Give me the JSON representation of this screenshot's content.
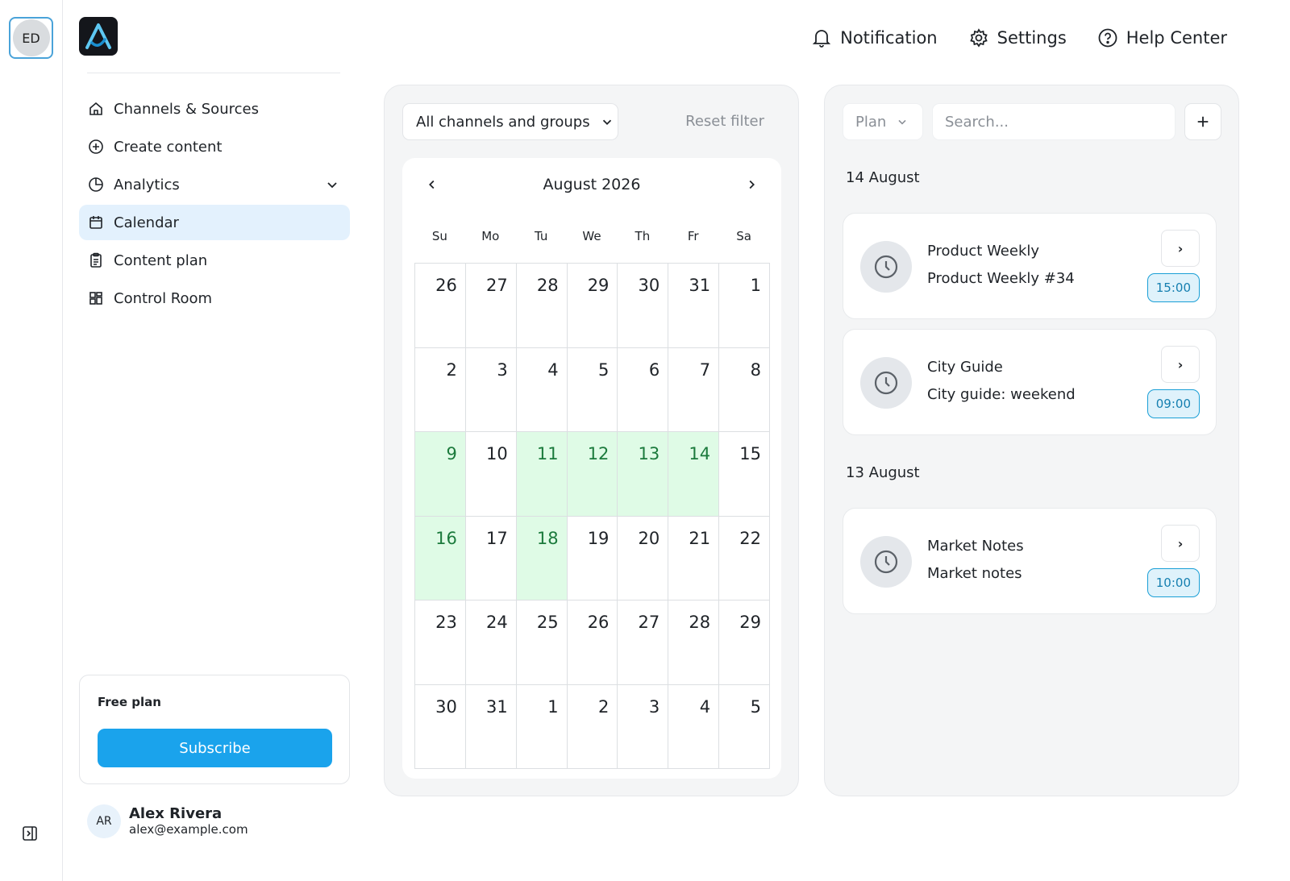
{
  "workspace": {
    "initials": "ED"
  },
  "sidebar": {
    "items": [
      {
        "label": "Channels & Sources",
        "icon": "home-icon"
      },
      {
        "label": "Create content",
        "icon": "plus-circle-icon"
      },
      {
        "label": "Analytics",
        "icon": "pie-chart-icon",
        "expandable": true
      },
      {
        "label": "Calendar",
        "icon": "calendar-icon",
        "active": true
      },
      {
        "label": "Content plan",
        "icon": "clipboard-icon"
      },
      {
        "label": "Control Room",
        "icon": "grid-icon"
      }
    ],
    "plan": {
      "label": "Free plan",
      "subscribe_label": "Subscribe"
    },
    "user": {
      "initials": "AR",
      "name": "Alex Rivera",
      "email": "alex@example.com"
    }
  },
  "topbar": {
    "notification": "Notification",
    "settings": "Settings",
    "help": "Help Center"
  },
  "calendar": {
    "filter_label": "All channels and groups",
    "reset_label": "Reset filter",
    "month_label": "August 2026",
    "weekdays": [
      "Su",
      "Mo",
      "Tu",
      "We",
      "Th",
      "Fr",
      "Sa"
    ],
    "days": [
      {
        "d": "26"
      },
      {
        "d": "27"
      },
      {
        "d": "28"
      },
      {
        "d": "29"
      },
      {
        "d": "30"
      },
      {
        "d": "31"
      },
      {
        "d": "1"
      },
      {
        "d": "2"
      },
      {
        "d": "3"
      },
      {
        "d": "4"
      },
      {
        "d": "5"
      },
      {
        "d": "6"
      },
      {
        "d": "7"
      },
      {
        "d": "8"
      },
      {
        "d": "9",
        "hl": true
      },
      {
        "d": "10"
      },
      {
        "d": "11",
        "hl": true
      },
      {
        "d": "12",
        "hl": true
      },
      {
        "d": "13",
        "hl": true
      },
      {
        "d": "14",
        "hl": true
      },
      {
        "d": "15"
      },
      {
        "d": "16",
        "hl": true
      },
      {
        "d": "17"
      },
      {
        "d": "18",
        "hl": true
      },
      {
        "d": "19"
      },
      {
        "d": "20"
      },
      {
        "d": "21"
      },
      {
        "d": "22"
      },
      {
        "d": "23"
      },
      {
        "d": "24"
      },
      {
        "d": "25"
      },
      {
        "d": "26"
      },
      {
        "d": "27"
      },
      {
        "d": "28"
      },
      {
        "d": "29"
      },
      {
        "d": "30"
      },
      {
        "d": "31"
      },
      {
        "d": "1"
      },
      {
        "d": "2"
      },
      {
        "d": "3"
      },
      {
        "d": "4"
      },
      {
        "d": "5"
      }
    ],
    "highlight_color": "#dffbe6"
  },
  "list": {
    "plan_label": "Plan",
    "search_placeholder": "Search...",
    "groups": [
      {
        "date": "14 August",
        "events": [
          {
            "title": "Product Weekly",
            "subtitle": "Product Weekly #34",
            "time": "15:00"
          },
          {
            "title": "City Guide",
            "subtitle": "City guide: weekend",
            "time": "09:00"
          }
        ]
      },
      {
        "date": "13 August",
        "events": [
          {
            "title": "Market Notes",
            "subtitle": "Market notes",
            "time": "10:00"
          }
        ]
      }
    ]
  },
  "colors": {
    "accent": "#1aa3ec",
    "active_nav": "#e3f1fd",
    "time_badge_border": "#1a9fd6"
  }
}
